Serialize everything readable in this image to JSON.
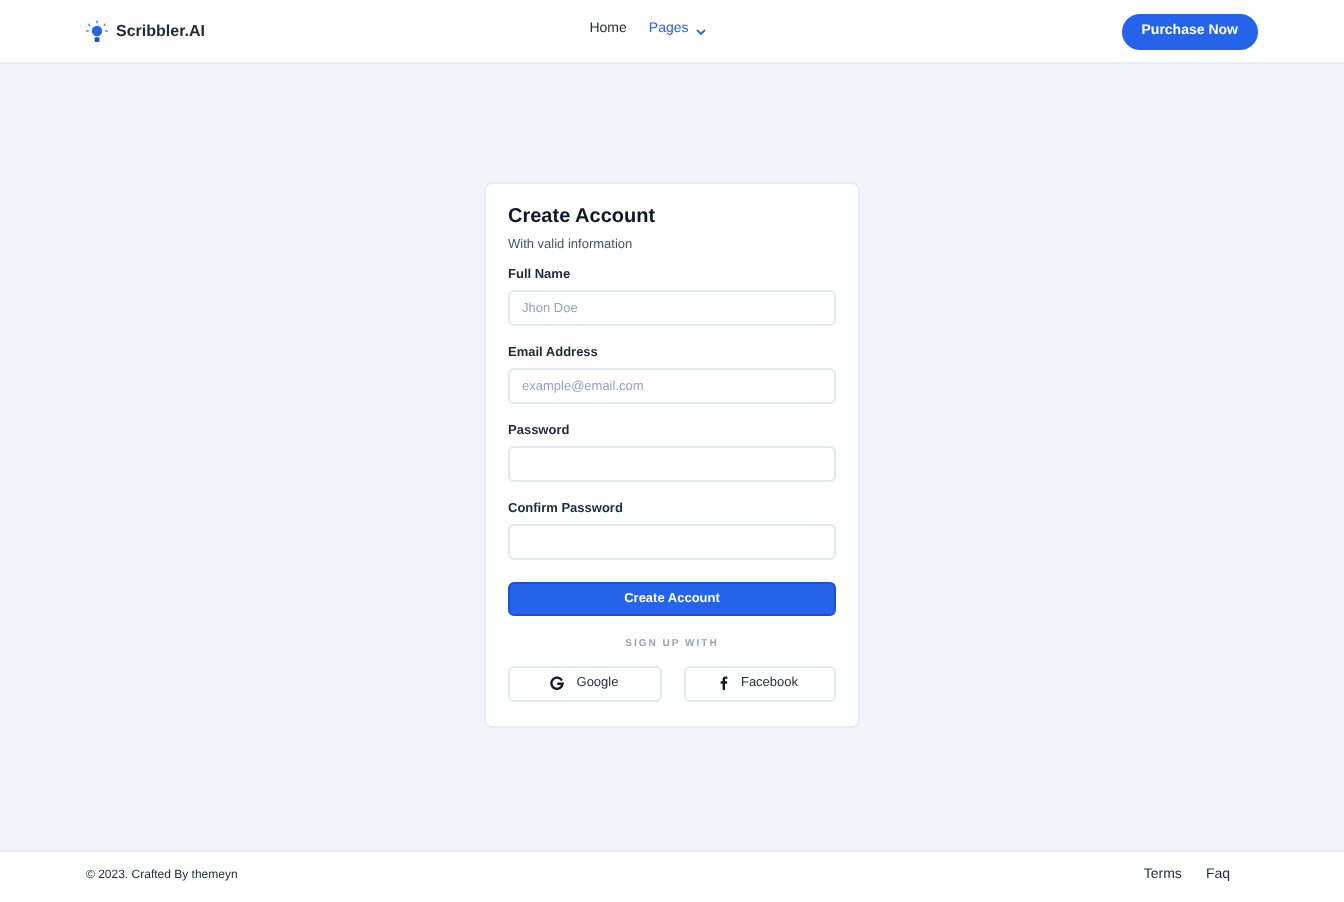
{
  "brand": {
    "name": "Scribbler.AI"
  },
  "nav": [
    {
      "label": "Home",
      "selected": false,
      "dropdown": false
    },
    {
      "label": "Pages",
      "selected": true,
      "dropdown": true
    }
  ],
  "header_button": "Purchase Now",
  "form": {
    "title": "Create Account",
    "subtitle": "With valid information",
    "fields": [
      {
        "label": "Full Name",
        "placeholder": "Jhon Doe"
      },
      {
        "label": "Email Address",
        "placeholder": "example@email.com"
      },
      {
        "label": "Password"
      },
      {
        "label": "Confirm Password"
      }
    ],
    "submit": "Create Account",
    "divider": "SIGN UP WITH",
    "social": [
      {
        "kind": "google",
        "label": "Google"
      },
      {
        "kind": "facebook",
        "label": "Facebook"
      }
    ]
  },
  "footer": {
    "copyright": "© 2023. Crafted By themeyn",
    "links": [
      "Terms",
      "Faq"
    ]
  }
}
